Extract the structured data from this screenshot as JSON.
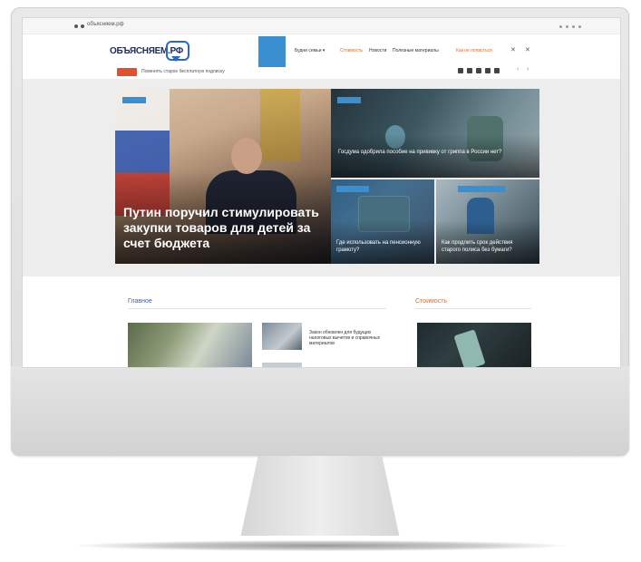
{
  "browser": {
    "url": "объясняем.рф"
  },
  "site": {
    "logo_text": "ОБЪЯСНЯЕМ.РФ"
  },
  "nav": {
    "items": [
      {
        "label": "Будни семьи ▾",
        "accent": false
      },
      {
        "label": "Стоимость",
        "accent": true
      },
      {
        "label": "Новости",
        "accent": false
      },
      {
        "label": "Полезные материалы",
        "accent": false
      },
      {
        "label": "Как не попасться",
        "accent": true
      }
    ]
  },
  "ticker": {
    "text": "Поменять старое бесплатную подписку"
  },
  "hero": {
    "title": "Путин поручил стимулировать закупки товаров для детей за счет бюджета"
  },
  "tiles": [
    {
      "title": "Госдума одобрила пособие на прививку от гриппа в России нет?"
    },
    {
      "title": "Где использовать на пенсионную грамоту?"
    },
    {
      "title": "Как продлить срок действия старого полиса без бумаги?"
    }
  ],
  "sections": {
    "left_title": "Главное",
    "right_title": "Стоимость"
  },
  "cards": [
    {
      "title": "Закон обновлен для будущих налоговых вычетов и справочных материалов"
    }
  ],
  "colors": {
    "accent_blue": "#3a8fd1",
    "accent_orange": "#e2692a",
    "logo_blue": "#2b67c4"
  }
}
